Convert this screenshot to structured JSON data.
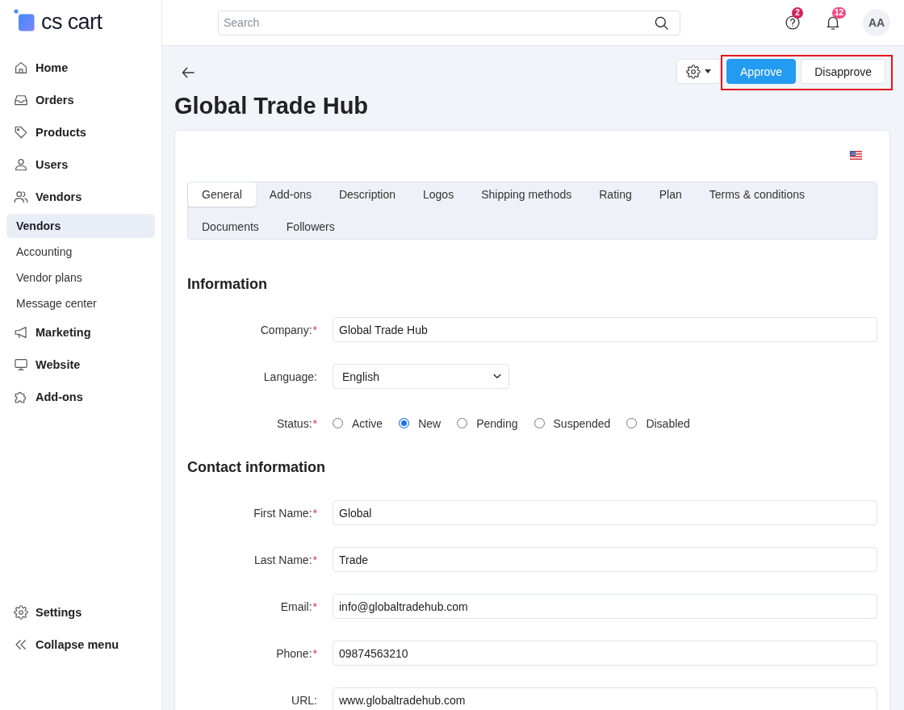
{
  "sidebar": {
    "logo": "cs cart",
    "nav": [
      {
        "label": "Home",
        "selected": false
      },
      {
        "label": "Orders",
        "selected": false
      },
      {
        "label": "Products",
        "selected": false
      },
      {
        "label": "Users",
        "selected": false
      },
      {
        "label": "Vendors",
        "selected": false,
        "children": [
          {
            "label": "Vendors",
            "selected": true
          },
          {
            "label": "Accounting",
            "selected": false
          },
          {
            "label": "Vendor plans",
            "selected": false
          },
          {
            "label": "Message center",
            "selected": false
          }
        ]
      },
      {
        "label": "Marketing",
        "selected": false
      },
      {
        "label": "Website",
        "selected": false
      },
      {
        "label": "Add-ons",
        "selected": false
      }
    ],
    "footer": [
      {
        "label": "Settings"
      },
      {
        "label": "Collapse menu"
      }
    ]
  },
  "topbar": {
    "search": {
      "placeholder": "Search"
    },
    "indicators": [
      {
        "kind": "help",
        "badge": "2",
        "color": "#d3245c"
      },
      {
        "kind": "notifications",
        "badge": "12",
        "color": "#ee4d85"
      }
    ],
    "avatar": "AA"
  },
  "header": {
    "title": "Global Trade Hub",
    "actions": {
      "highlighted": true,
      "buttons": [
        {
          "label": "Approve",
          "kind": "primary"
        },
        {
          "label": "Disapprove",
          "kind": "default"
        }
      ]
    }
  },
  "tabs": [
    {
      "label": "General",
      "selected": true
    },
    {
      "label": "Add-ons",
      "selected": false
    },
    {
      "label": "Description",
      "selected": false
    },
    {
      "label": "Logos",
      "selected": false
    },
    {
      "label": "Shipping methods",
      "selected": false
    },
    {
      "label": "Rating",
      "selected": false
    },
    {
      "label": "Plan",
      "selected": false
    },
    {
      "label": "Terms & conditions",
      "selected": false
    },
    {
      "label": "Documents",
      "selected": false
    },
    {
      "label": "Followers",
      "selected": false
    }
  ],
  "sections": [
    {
      "title": "Information",
      "fields": [
        {
          "kind": "text",
          "label": "Company:",
          "required_mark": "*",
          "value": "Global Trade Hub"
        },
        {
          "kind": "select",
          "label": "Language:",
          "value": "English"
        },
        {
          "kind": "radio",
          "label": "Status:",
          "required_mark": "*",
          "options": [
            {
              "label": "Active",
              "selected": false
            },
            {
              "label": "New",
              "selected": true
            },
            {
              "label": "Pending",
              "selected": false
            },
            {
              "label": "Suspended",
              "selected": false
            },
            {
              "label": "Disabled",
              "selected": false
            }
          ]
        }
      ]
    },
    {
      "title": "Contact information",
      "fields": [
        {
          "kind": "text",
          "label": "First Name:",
          "required_mark": "*",
          "value": "Global"
        },
        {
          "kind": "text",
          "label": "Last Name:",
          "required_mark": "*",
          "value": "Trade"
        },
        {
          "kind": "text",
          "label": "Email:",
          "required_mark": "*",
          "value": "info@globaltradehub.com"
        },
        {
          "kind": "text",
          "label": "Phone:",
          "required_mark": "*",
          "value": "09874563210"
        },
        {
          "kind": "text",
          "label": "URL:",
          "value": "www.globaltradehub.com"
        }
      ]
    }
  ]
}
